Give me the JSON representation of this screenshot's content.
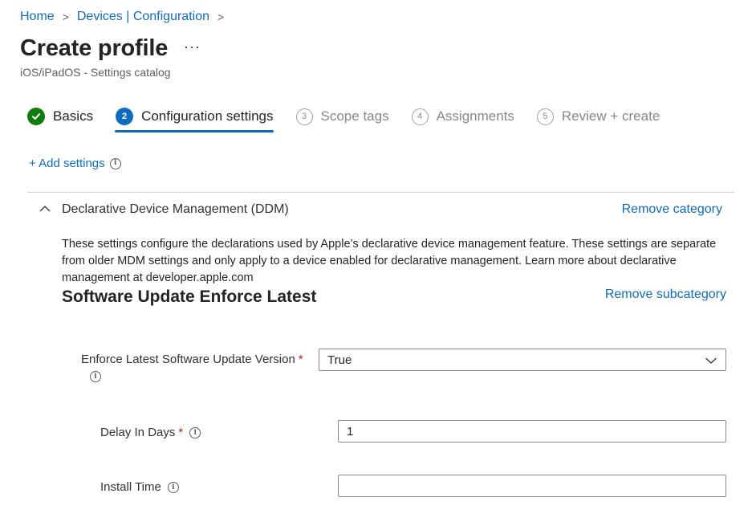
{
  "breadcrumb": {
    "items": [
      "Home",
      "Devices | Configuration"
    ],
    "separator": ">"
  },
  "page": {
    "title": "Create profile",
    "more": "···",
    "subtitle": "iOS/iPadOS - Settings catalog"
  },
  "steps": [
    {
      "label": "Basics",
      "state": "done"
    },
    {
      "number": "2",
      "label": "Configuration settings",
      "state": "current"
    },
    {
      "number": "3",
      "label": "Scope tags",
      "state": "future"
    },
    {
      "number": "4",
      "label": "Assignments",
      "state": "future"
    },
    {
      "number": "5",
      "label": "Review + create",
      "state": "future"
    }
  ],
  "add_settings": {
    "label": "+ Add settings",
    "info": "i"
  },
  "category": {
    "title": "Declarative Device Management (DDM)",
    "remove_label": "Remove category",
    "description": "These settings configure the declarations used by Apple’s declarative device management feature. These settings are separate from older MDM settings and only apply to a device enabled for declarative management. Learn more about declarative management at developer.apple.com"
  },
  "subcategory": {
    "title": "Software Update Enforce Latest",
    "remove_label": "Remove subcategory"
  },
  "fields": {
    "enforce_latest": {
      "label": "Enforce Latest Software Update Version",
      "required": "*",
      "info": "i",
      "value": "True"
    },
    "delay_in_days": {
      "label": "Delay In Days",
      "required": "*",
      "info": "i",
      "value": "1"
    },
    "install_time": {
      "label": "Install Time",
      "info": "i",
      "value": ""
    }
  },
  "colors": {
    "link": "#0f6cbd",
    "success": "#107c10",
    "required": "#a4262c"
  }
}
